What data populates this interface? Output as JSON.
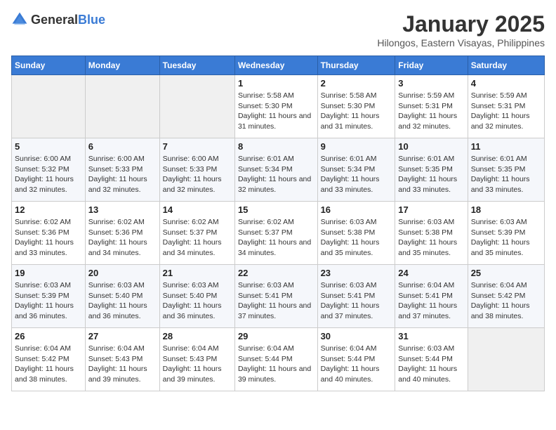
{
  "logo": {
    "text_general": "General",
    "text_blue": "Blue"
  },
  "title": "January 2025",
  "subtitle": "Hilongos, Eastern Visayas, Philippines",
  "header_days": [
    "Sunday",
    "Monday",
    "Tuesday",
    "Wednesday",
    "Thursday",
    "Friday",
    "Saturday"
  ],
  "weeks": [
    [
      {
        "day": "",
        "sunrise": "",
        "sunset": "",
        "daylight": ""
      },
      {
        "day": "",
        "sunrise": "",
        "sunset": "",
        "daylight": ""
      },
      {
        "day": "",
        "sunrise": "",
        "sunset": "",
        "daylight": ""
      },
      {
        "day": "1",
        "sunrise": "Sunrise: 5:58 AM",
        "sunset": "Sunset: 5:30 PM",
        "daylight": "Daylight: 11 hours and 31 minutes."
      },
      {
        "day": "2",
        "sunrise": "Sunrise: 5:58 AM",
        "sunset": "Sunset: 5:30 PM",
        "daylight": "Daylight: 11 hours and 31 minutes."
      },
      {
        "day": "3",
        "sunrise": "Sunrise: 5:59 AM",
        "sunset": "Sunset: 5:31 PM",
        "daylight": "Daylight: 11 hours and 32 minutes."
      },
      {
        "day": "4",
        "sunrise": "Sunrise: 5:59 AM",
        "sunset": "Sunset: 5:31 PM",
        "daylight": "Daylight: 11 hours and 32 minutes."
      }
    ],
    [
      {
        "day": "5",
        "sunrise": "Sunrise: 6:00 AM",
        "sunset": "Sunset: 5:32 PM",
        "daylight": "Daylight: 11 hours and 32 minutes."
      },
      {
        "day": "6",
        "sunrise": "Sunrise: 6:00 AM",
        "sunset": "Sunset: 5:33 PM",
        "daylight": "Daylight: 11 hours and 32 minutes."
      },
      {
        "day": "7",
        "sunrise": "Sunrise: 6:00 AM",
        "sunset": "Sunset: 5:33 PM",
        "daylight": "Daylight: 11 hours and 32 minutes."
      },
      {
        "day": "8",
        "sunrise": "Sunrise: 6:01 AM",
        "sunset": "Sunset: 5:34 PM",
        "daylight": "Daylight: 11 hours and 32 minutes."
      },
      {
        "day": "9",
        "sunrise": "Sunrise: 6:01 AM",
        "sunset": "Sunset: 5:34 PM",
        "daylight": "Daylight: 11 hours and 33 minutes."
      },
      {
        "day": "10",
        "sunrise": "Sunrise: 6:01 AM",
        "sunset": "Sunset: 5:35 PM",
        "daylight": "Daylight: 11 hours and 33 minutes."
      },
      {
        "day": "11",
        "sunrise": "Sunrise: 6:01 AM",
        "sunset": "Sunset: 5:35 PM",
        "daylight": "Daylight: 11 hours and 33 minutes."
      }
    ],
    [
      {
        "day": "12",
        "sunrise": "Sunrise: 6:02 AM",
        "sunset": "Sunset: 5:36 PM",
        "daylight": "Daylight: 11 hours and 33 minutes."
      },
      {
        "day": "13",
        "sunrise": "Sunrise: 6:02 AM",
        "sunset": "Sunset: 5:36 PM",
        "daylight": "Daylight: 11 hours and 34 minutes."
      },
      {
        "day": "14",
        "sunrise": "Sunrise: 6:02 AM",
        "sunset": "Sunset: 5:37 PM",
        "daylight": "Daylight: 11 hours and 34 minutes."
      },
      {
        "day": "15",
        "sunrise": "Sunrise: 6:02 AM",
        "sunset": "Sunset: 5:37 PM",
        "daylight": "Daylight: 11 hours and 34 minutes."
      },
      {
        "day": "16",
        "sunrise": "Sunrise: 6:03 AM",
        "sunset": "Sunset: 5:38 PM",
        "daylight": "Daylight: 11 hours and 35 minutes."
      },
      {
        "day": "17",
        "sunrise": "Sunrise: 6:03 AM",
        "sunset": "Sunset: 5:38 PM",
        "daylight": "Daylight: 11 hours and 35 minutes."
      },
      {
        "day": "18",
        "sunrise": "Sunrise: 6:03 AM",
        "sunset": "Sunset: 5:39 PM",
        "daylight": "Daylight: 11 hours and 35 minutes."
      }
    ],
    [
      {
        "day": "19",
        "sunrise": "Sunrise: 6:03 AM",
        "sunset": "Sunset: 5:39 PM",
        "daylight": "Daylight: 11 hours and 36 minutes."
      },
      {
        "day": "20",
        "sunrise": "Sunrise: 6:03 AM",
        "sunset": "Sunset: 5:40 PM",
        "daylight": "Daylight: 11 hours and 36 minutes."
      },
      {
        "day": "21",
        "sunrise": "Sunrise: 6:03 AM",
        "sunset": "Sunset: 5:40 PM",
        "daylight": "Daylight: 11 hours and 36 minutes."
      },
      {
        "day": "22",
        "sunrise": "Sunrise: 6:03 AM",
        "sunset": "Sunset: 5:41 PM",
        "daylight": "Daylight: 11 hours and 37 minutes."
      },
      {
        "day": "23",
        "sunrise": "Sunrise: 6:03 AM",
        "sunset": "Sunset: 5:41 PM",
        "daylight": "Daylight: 11 hours and 37 minutes."
      },
      {
        "day": "24",
        "sunrise": "Sunrise: 6:04 AM",
        "sunset": "Sunset: 5:41 PM",
        "daylight": "Daylight: 11 hours and 37 minutes."
      },
      {
        "day": "25",
        "sunrise": "Sunrise: 6:04 AM",
        "sunset": "Sunset: 5:42 PM",
        "daylight": "Daylight: 11 hours and 38 minutes."
      }
    ],
    [
      {
        "day": "26",
        "sunrise": "Sunrise: 6:04 AM",
        "sunset": "Sunset: 5:42 PM",
        "daylight": "Daylight: 11 hours and 38 minutes."
      },
      {
        "day": "27",
        "sunrise": "Sunrise: 6:04 AM",
        "sunset": "Sunset: 5:43 PM",
        "daylight": "Daylight: 11 hours and 39 minutes."
      },
      {
        "day": "28",
        "sunrise": "Sunrise: 6:04 AM",
        "sunset": "Sunset: 5:43 PM",
        "daylight": "Daylight: 11 hours and 39 minutes."
      },
      {
        "day": "29",
        "sunrise": "Sunrise: 6:04 AM",
        "sunset": "Sunset: 5:44 PM",
        "daylight": "Daylight: 11 hours and 39 minutes."
      },
      {
        "day": "30",
        "sunrise": "Sunrise: 6:04 AM",
        "sunset": "Sunset: 5:44 PM",
        "daylight": "Daylight: 11 hours and 40 minutes."
      },
      {
        "day": "31",
        "sunrise": "Sunrise: 6:03 AM",
        "sunset": "Sunset: 5:44 PM",
        "daylight": "Daylight: 11 hours and 40 minutes."
      },
      {
        "day": "",
        "sunrise": "",
        "sunset": "",
        "daylight": ""
      }
    ]
  ]
}
